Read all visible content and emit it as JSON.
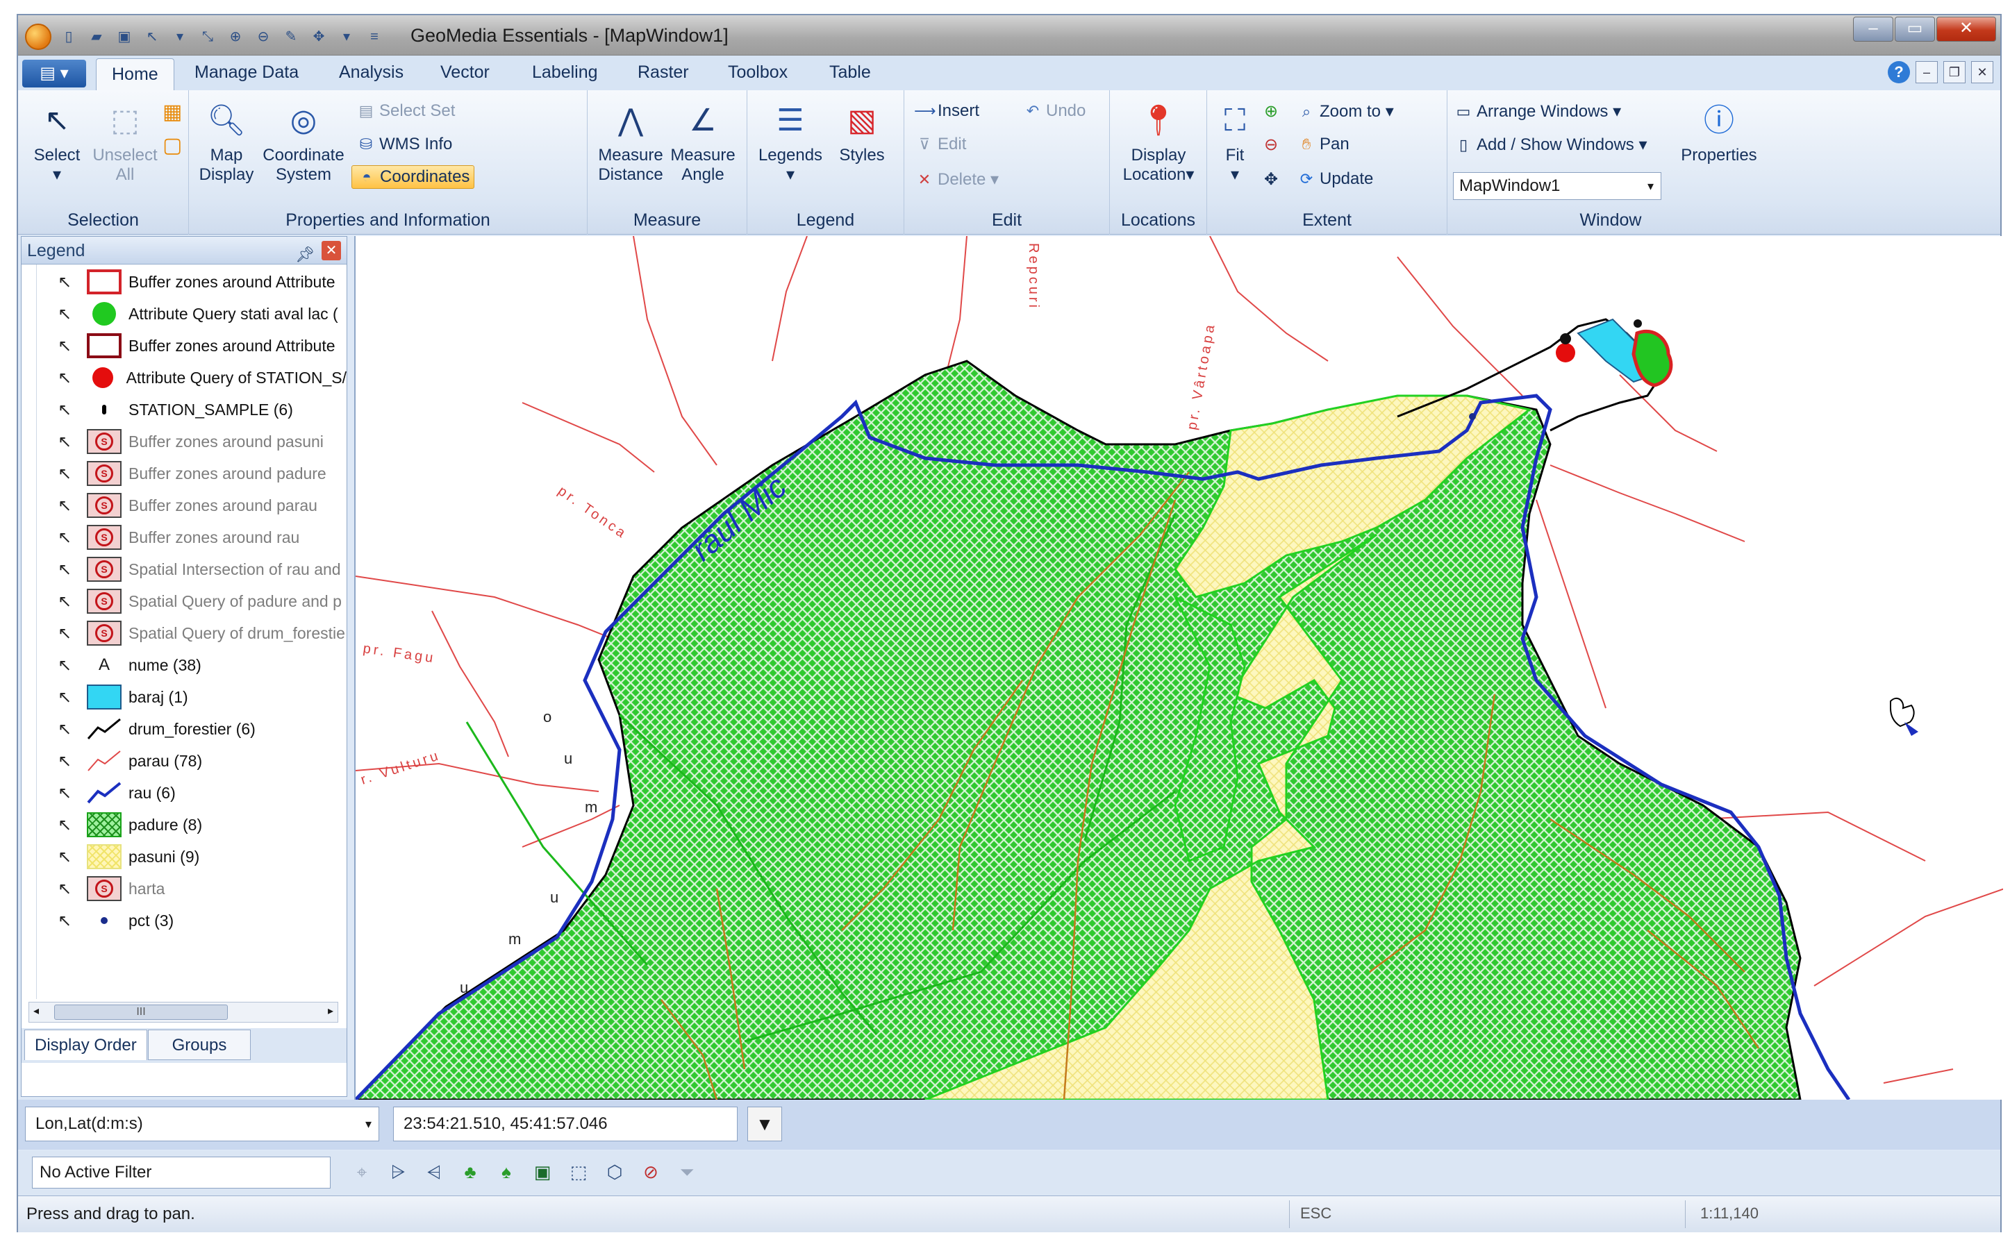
{
  "window": {
    "title": "GeoMedia Essentials - [MapWindow1]"
  },
  "ribbon_tabs": [
    "Home",
    "Manage Data",
    "Analysis",
    "Vector",
    "Labeling",
    "Raster",
    "Toolbox",
    "Table"
  ],
  "ribbon": {
    "selection": {
      "label": "Selection",
      "select": "Select",
      "unselect_1": "Unselect",
      "unselect_2": "All"
    },
    "properties": {
      "label": "Properties and Information",
      "map_display_1": "Map",
      "map_display_2": "Display",
      "coord_1": "Coordinate",
      "coord_2": "System",
      "select_set": "Select Set",
      "wms_info": "WMS Info",
      "coordinates": "Coordinates"
    },
    "measure": {
      "label": "Measure",
      "dist_1": "Measure",
      "dist_2": "Distance",
      "angle_1": "Measure",
      "angle_2": "Angle"
    },
    "legend": {
      "label": "Legend",
      "legends": "Legends",
      "styles": "Styles"
    },
    "edit": {
      "label": "Edit",
      "insert": "Insert",
      "edit": "Edit",
      "delete": "Delete",
      "undo": "Undo"
    },
    "locations": {
      "label": "Locations",
      "display_1": "Display",
      "display_2": "Location"
    },
    "extent": {
      "label": "Extent",
      "fit": "Fit",
      "zoom_to": "Zoom to",
      "pan": "Pan",
      "update": "Update"
    },
    "window": {
      "label": "Window",
      "arrange": "Arrange Windows",
      "add_show": "Add / Show Windows",
      "combo": "MapWindow1",
      "properties": "Properties"
    }
  },
  "legend_panel": {
    "title": "Legend",
    "items": [
      {
        "label": "Buffer zones around Attribute",
        "symbol": "outline-red",
        "active": true
      },
      {
        "label": "Attribute Query stati aval lac (",
        "symbol": "dot-green",
        "active": true
      },
      {
        "label": "Buffer zones around Attribute",
        "symbol": "outline-darkred",
        "active": true
      },
      {
        "label": "Attribute Query of STATION_S/",
        "symbol": "dot-red",
        "active": true
      },
      {
        "label": "STATION_SAMPLE (6)",
        "symbol": "tiny-black",
        "active": true
      },
      {
        "label": "Buffer zones around pasuni",
        "symbol": "off",
        "active": false
      },
      {
        "label": "Buffer zones around padure",
        "symbol": "off",
        "active": false
      },
      {
        "label": "Buffer zones around parau",
        "symbol": "off",
        "active": false
      },
      {
        "label": "Buffer zones around rau",
        "symbol": "off",
        "active": false
      },
      {
        "label": "Spatial Intersection of rau and",
        "symbol": "off",
        "active": false
      },
      {
        "label": "Spatial Query of padure and p",
        "symbol": "off",
        "active": false
      },
      {
        "label": "Spatial Query of drum_forestie",
        "symbol": "off",
        "active": false
      },
      {
        "label": "nume (38)",
        "symbol": "text",
        "active": true
      },
      {
        "label": "baraj (1)",
        "symbol": "cyan",
        "active": true
      },
      {
        "label": "drum_forestier (6)",
        "symbol": "line-black",
        "active": true
      },
      {
        "label": "parau (78)",
        "symbol": "line-pink",
        "active": true
      },
      {
        "label": "rau (6)",
        "symbol": "line-blue",
        "active": true
      },
      {
        "label": "padure (8)",
        "symbol": "hatch-green",
        "active": true
      },
      {
        "label": "pasuni (9)",
        "symbol": "hatch-yellow",
        "active": true
      },
      {
        "label": "harta",
        "symbol": "off",
        "active": false
      },
      {
        "label": "pct (3)",
        "symbol": "dot-blue",
        "active": true
      }
    ],
    "text_symbol": "A",
    "scroll_thumb": "III",
    "tabs": [
      "Display Order",
      "Groups"
    ]
  },
  "map": {
    "labels": {
      "raul_mic": "râul Mic",
      "tonca": "pr. Tonca",
      "fagu": "pr. Fagu",
      "vulturu": "r. Vulturu",
      "repcuri": "Repcuri",
      "varroapa": "pr. Vârtoapa",
      "sub_a": "o",
      "sub_b": "u",
      "sub_c": "m",
      "sub_d": "u",
      "sub_e": "m",
      "sub_f": "u"
    }
  },
  "coordbar": {
    "system": "Lon,Lat(d:m:s)",
    "value": "23:54:21.510, 45:41:57.046"
  },
  "filterbar": {
    "filter": "No Active Filter"
  },
  "status": {
    "message": "Press and drag to pan.",
    "esc": "ESC",
    "scale": "1:11,140"
  },
  "colors": {
    "forest": "#1fc41f",
    "pasture": "#fbf1a0",
    "river": "#1b2fbf",
    "stream": "#e04848",
    "road": "#c47a1c"
  }
}
